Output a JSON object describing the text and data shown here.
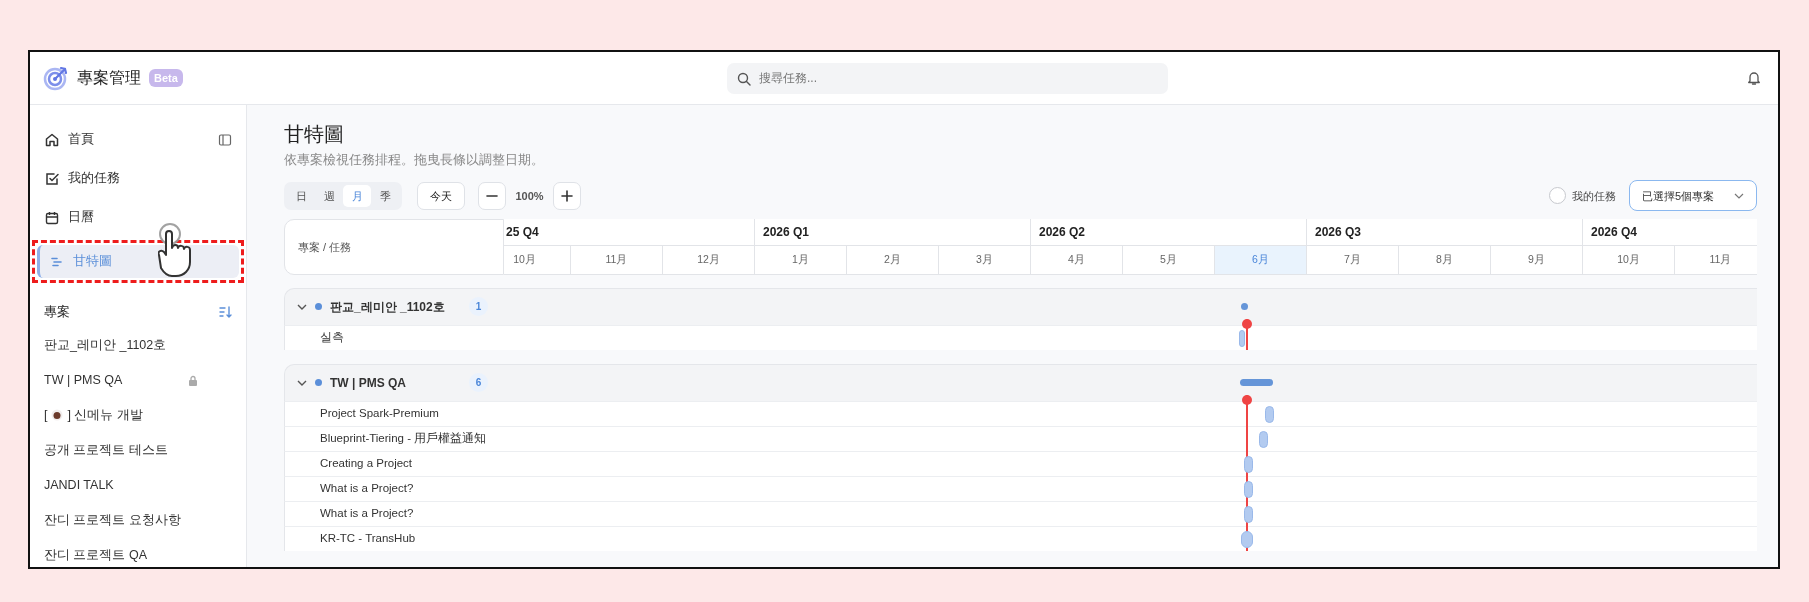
{
  "app": {
    "title": "專案管理",
    "badge": "Beta"
  },
  "search": {
    "placeholder": "搜尋任務..."
  },
  "sidebar": {
    "nav": [
      {
        "label": "首頁",
        "selected": false,
        "highlighted": false
      },
      {
        "label": "我的任務",
        "selected": false,
        "highlighted": false
      },
      {
        "label": "日曆",
        "selected": false,
        "highlighted": false
      },
      {
        "label": "甘特圖",
        "selected": true,
        "highlighted": true
      }
    ],
    "section_title": "專案",
    "projects": [
      {
        "kind": "text",
        "name": "판교_레미안 _1102호",
        "locked": false
      },
      {
        "kind": "text",
        "name": "TW | PMS QA",
        "locked": true
      },
      {
        "kind": "emoji",
        "before": "[",
        "after": "] 신메뉴 개발",
        "locked": false
      },
      {
        "kind": "text",
        "name": "공개 프로젝트 테스트",
        "locked": false
      },
      {
        "kind": "text",
        "name": "JANDI TALK",
        "locked": false
      },
      {
        "kind": "text",
        "name": "잔디 프로젝트 요청사항",
        "locked": false
      },
      {
        "kind": "text",
        "name": "잔디 프로젝트 QA",
        "locked": false
      }
    ]
  },
  "page": {
    "title": "甘特圖",
    "subtitle": "依專案檢視任務排程。拖曳長條以調整日期。"
  },
  "toolbar": {
    "scales": [
      {
        "label": "日",
        "selected": false
      },
      {
        "label": "週",
        "selected": false
      },
      {
        "label": "月",
        "selected": true
      },
      {
        "label": "季",
        "selected": false
      }
    ],
    "today_button": "今天",
    "zoom": "100%",
    "my_tasks": {
      "label": "我的任務",
      "checked": false
    },
    "project_select": "已選擇5個專案"
  },
  "gantt": {
    "column_header": "專案 / 任務",
    "quarters": [
      {
        "label": "25 Q4",
        "months": [
          {
            "label": "10月",
            "current": false
          },
          {
            "label": "11月",
            "current": false
          },
          {
            "label": "12月",
            "current": false
          }
        ]
      },
      {
        "label": "2026 Q1",
        "months": [
          {
            "label": "1月",
            "current": false
          },
          {
            "label": "2月",
            "current": false
          },
          {
            "label": "3月",
            "current": false
          }
        ]
      },
      {
        "label": "2026 Q2",
        "months": [
          {
            "label": "4月",
            "current": false
          },
          {
            "label": "5月",
            "current": false
          },
          {
            "label": "6月",
            "current": true
          }
        ]
      },
      {
        "label": "2026 Q3",
        "months": [
          {
            "label": "7月",
            "current": false
          },
          {
            "label": "8月",
            "current": false
          },
          {
            "label": "9月",
            "current": false
          }
        ]
      },
      {
        "label": "2026 Q4",
        "months": [
          {
            "label": "10月",
            "current": false
          },
          {
            "label": "11月",
            "current": false
          }
        ]
      }
    ],
    "groups": [
      {
        "name": "판교_레미안 _1102호",
        "count": "1",
        "color": "#5b8fd9",
        "expanded": true,
        "tasks": [
          {
            "name": "실측"
          }
        ]
      },
      {
        "name": "TW | PMS QA",
        "count": "6",
        "color": "#5b8fd9",
        "expanded": true,
        "tasks": [
          {
            "name": "Project Spark-Premium"
          },
          {
            "name": "Blueprint-Tiering - 用戶權益通知"
          },
          {
            "name": "Creating a Project"
          },
          {
            "name": "What is a Project?"
          },
          {
            "name": "What is a Project?"
          },
          {
            "name": "KR-TC - TransHub"
          }
        ]
      }
    ]
  }
}
